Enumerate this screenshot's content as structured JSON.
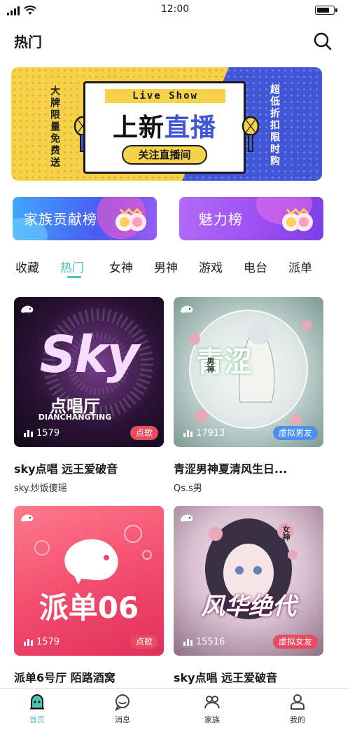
{
  "status": {
    "time": "12:00",
    "battery_level": 0.8
  },
  "nav": {
    "title": "热门",
    "search_icon": "search-icon"
  },
  "banner": {
    "tag": "Live Show",
    "main_black": "上新",
    "main_blue": "直播",
    "button": "关注直播间",
    "left_text": "大牌限量免费送",
    "right_text": "超低折扣限时购",
    "colors": {
      "yellow": "#f6d14a",
      "blue": "#3f57d6"
    }
  },
  "ranks": [
    {
      "label": "家族贡献榜"
    },
    {
      "label": "魅力榜"
    }
  ],
  "tabs": [
    {
      "label": "收藏",
      "active": false
    },
    {
      "label": "热门",
      "active": true
    },
    {
      "label": "女神",
      "active": false
    },
    {
      "label": "男神",
      "active": false
    },
    {
      "label": "游戏",
      "active": false
    },
    {
      "label": "电台",
      "active": false
    },
    {
      "label": "派单",
      "active": false
    }
  ],
  "accent": "#4cc2b8",
  "cards": [
    {
      "cover_main": "Sky",
      "cover_sub": "点唱厅",
      "cover_caption": "DIANCHANGTING",
      "count": "1579",
      "badge": "点歌",
      "title": "sky点唱 远王爱破音",
      "subtitle": "sky.炒饭傻瑶"
    },
    {
      "cover_main": "青涩",
      "cover_sub": "男神",
      "count": "17913",
      "badge": "虚拟男友",
      "title": "青涩男神夏清风生日...",
      "subtitle": "Qs.s男"
    },
    {
      "cover_main": "派单06",
      "count": "1579",
      "badge": "点歌",
      "title": "派单6号厅 陌路酒窝",
      "subtitle": ""
    },
    {
      "cover_main": "风华绝代",
      "cover_sub": "女神",
      "count": "15516",
      "badge": "虚拟女友",
      "title": "sky点唱 远王爱破音",
      "subtitle": ""
    }
  ],
  "tabbar": [
    {
      "label": "首页",
      "icon": "home-icon",
      "active": true
    },
    {
      "label": "消息",
      "icon": "message-icon",
      "active": false
    },
    {
      "label": "家族",
      "icon": "family-icon",
      "active": false
    },
    {
      "label": "我的",
      "icon": "profile-icon",
      "active": false
    }
  ]
}
